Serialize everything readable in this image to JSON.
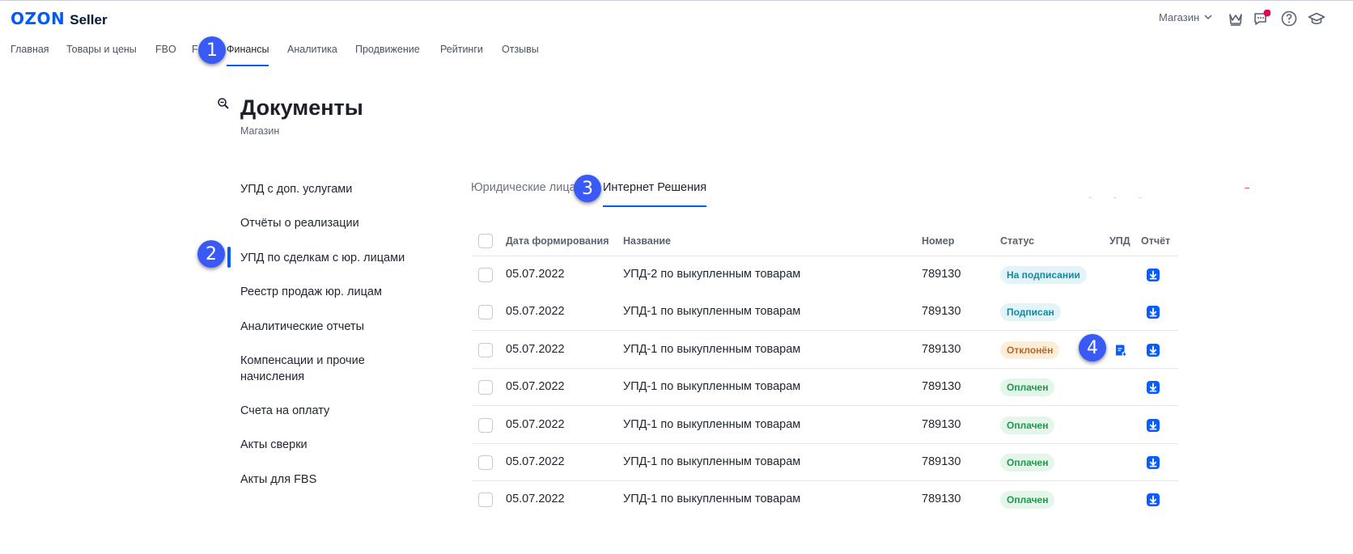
{
  "header": {
    "logo_brand": "OZON",
    "logo_product": "Seller",
    "store_label": "Магазин",
    "icons": [
      "crown-icon",
      "chat-icon",
      "help-icon",
      "academy-icon"
    ],
    "notification_color": "#e6004d"
  },
  "nav": {
    "items": [
      "Главная",
      "Товары и цены",
      "FBO",
      "F",
      "Финансы",
      "Аналитика",
      "Продвижение",
      "Рейтинги",
      "Отзывы"
    ],
    "active": "Финансы"
  },
  "page": {
    "title": "Документы",
    "subtitle": "Магазин"
  },
  "sidebar": {
    "items": [
      "УПД с доп. услугами",
      "Отчёты о реализации",
      "УПД по сделкам с юр. лицами",
      "Реестр продаж юр. лицам",
      "Аналитические отчеты",
      "Компенсации и прочие начисления",
      "Счета на оплату",
      "Акты сверки",
      "Акты для FBS"
    ],
    "active": "УПД по сделкам с юр. лицами"
  },
  "tabs": {
    "items": [
      "Юридические лица",
      "Интернет Решения"
    ],
    "active": "Интернет Решения"
  },
  "table": {
    "columns": [
      "Дата формирования",
      "Название",
      "Номер",
      "Статус",
      "УПД",
      "Отчёт"
    ],
    "rows": [
      {
        "date": "05.07.2022",
        "name": "УПД-2 по выкупленным товарам",
        "number": "789130",
        "status": "На подписании",
        "status_color": "blue",
        "upd": false
      },
      {
        "date": "05.07.2022",
        "name": "УПД-1 по выкупленным товарам",
        "number": "789130",
        "status": "Подписан",
        "status_color": "blue",
        "upd": false
      },
      {
        "date": "05.07.2022",
        "name": "УПД-1 по выкупленным товарам",
        "number": "789130",
        "status": "Отклонён",
        "status_color": "orange",
        "upd": true
      },
      {
        "date": "05.07.2022",
        "name": "УПД-1 по выкупленным товарам",
        "number": "789130",
        "status": "Оплачен",
        "status_color": "green",
        "upd": false
      },
      {
        "date": "05.07.2022",
        "name": "УПД-1 по выкупленным товарам",
        "number": "789130",
        "status": "Оплачен",
        "status_color": "green",
        "upd": false
      },
      {
        "date": "05.07.2022",
        "name": "УПД-1 по выкупленным товарам",
        "number": "789130",
        "status": "Оплачен",
        "status_color": "green",
        "upd": false
      },
      {
        "date": "05.07.2022",
        "name": "УПД-1 по выкупленным товарам",
        "number": "789130",
        "status": "Оплачен",
        "status_color": "green",
        "upd": false
      }
    ]
  },
  "annotations": [
    "1",
    "2",
    "3",
    "4"
  ],
  "colors": {
    "accent": "#005bff",
    "badge": "#3a5af8"
  }
}
